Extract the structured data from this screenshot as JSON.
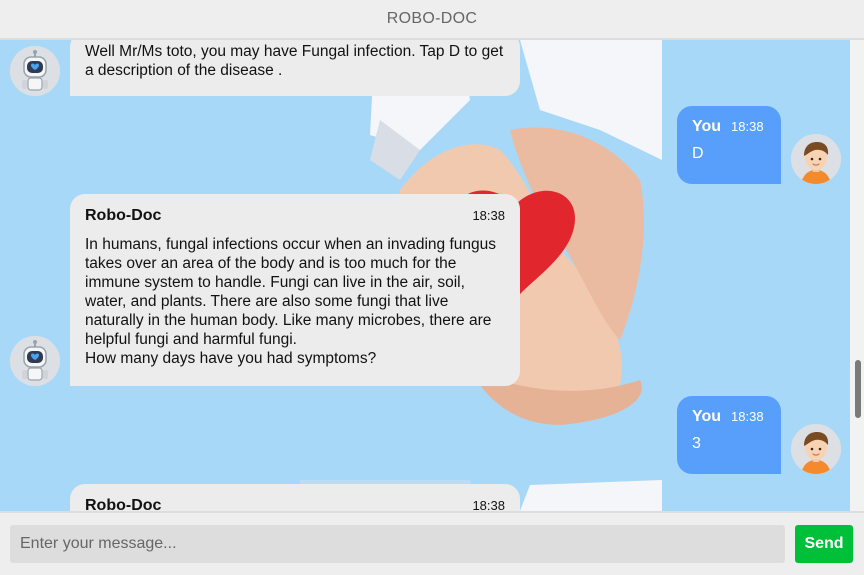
{
  "header": {
    "title": "ROBO-DOC"
  },
  "messages": [
    {
      "sender": "bot",
      "text": "Well Mr/Ms toto, you may have Fungal infection. Tap D to get a description of the disease ."
    },
    {
      "sender": "user",
      "name": "You",
      "time": "18:38",
      "text": "D"
    },
    {
      "sender": "bot",
      "name": "Robo-Doc",
      "time": "18:38",
      "text": "In humans, fungal infections occur when an invading fungus takes over an area of the body and is too much for the immune system to handle. Fungi can live in the air, soil, water, and plants. There are also some fungi that live naturally in the human body. Like many microbes, there are helpful fungi and harmful fungi.\nHow many days have you had symptoms?"
    },
    {
      "sender": "user",
      "name": "You",
      "time": "18:38",
      "text": "3"
    },
    {
      "sender": "bot",
      "name": "Robo-Doc",
      "time": "18:38",
      "text": ""
    }
  ],
  "composer": {
    "placeholder": "Enter your message...",
    "send_label": "Send"
  },
  "colors": {
    "bot_bubble": "#ececec",
    "user_bubble": "#579ffb",
    "send_button": "#00c03a",
    "chat_background": "#a8d8f8"
  },
  "icons": {
    "bot_avatar": "robot-avatar-icon",
    "user_avatar": "boy-avatar-icon"
  }
}
